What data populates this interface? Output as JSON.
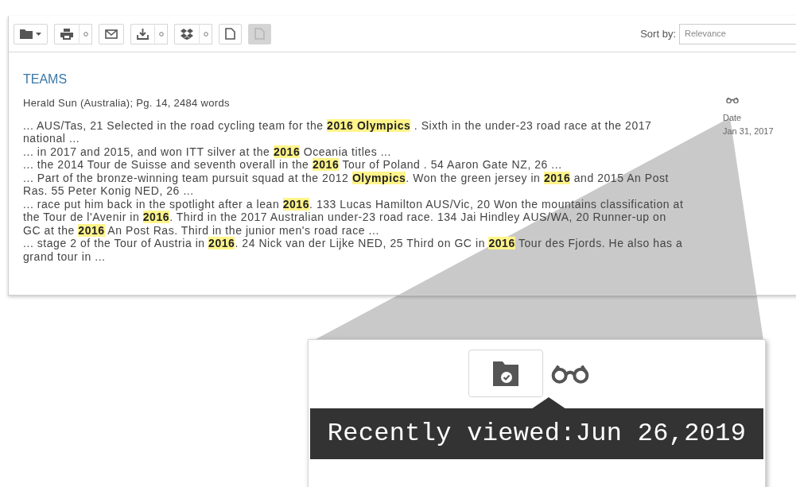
{
  "toolbar": {
    "buttons": [
      {
        "kind": "folder",
        "caret": true,
        "options": false,
        "disabled": false
      },
      {
        "kind": "print",
        "caret": false,
        "options": true,
        "disabled": false
      },
      {
        "kind": "email",
        "caret": false,
        "options": false,
        "disabled": false
      },
      {
        "kind": "download",
        "caret": false,
        "options": true,
        "disabled": false
      },
      {
        "kind": "dropbox",
        "caret": false,
        "options": true,
        "disabled": false
      },
      {
        "kind": "document",
        "caret": false,
        "options": false,
        "disabled": false
      },
      {
        "kind": "document",
        "caret": false,
        "options": false,
        "disabled": true
      }
    ],
    "sort": {
      "label": "Sort by:",
      "value": "Relevance"
    }
  },
  "result": {
    "title": "TEAMS",
    "source": "Herald Sun (Australia); Pg. 14, 2484 words",
    "snippets": [
      "... AUS/Tas, 21 Selected in the road cycling team for the **2016 Olympics** . Sixth in the under-23 road race at the 2017 national ...",
      "... in 2017 and 2015, and won ITT silver at the **2016** Oceania titles ...",
      "... the 2014 Tour de Suisse and seventh overall in the **2016** Tour of Poland . 54 Aaron Gate NZ, 26 ...",
      "... Part of the bronze-winning team pursuit squad at the 2012 **Olympics**. Won the green jersey in **2016** and 2015 An Post Ras. 55 Peter Konig NED, 26 ...",
      "... race put him back in the spotlight after a lean **2016**. 133 Lucas Hamilton AUS/Vic, 20 Won the mountains classification at the Tour de l'Avenir in **2016**. Third in the 2017 Australian under-23 road race. 134 Jai Hindley AUS/WA, 20 Runner-up on GC at the **2016** An Post Ras. Third in the junior men's road race ...",
      "... stage 2 of the Tour of Austria in **2016**. 24 Nick van der Lijke NED, 25 Third on GC in **2016** Tour des Fjords. He also has a grand tour in ..."
    ],
    "recently_viewed": true,
    "date_label": "Date",
    "date": "Jan 31, 2017"
  },
  "zoom_inset": {
    "recently_viewed": true,
    "tooltip": "Recently viewed:Jun 26,2019"
  }
}
